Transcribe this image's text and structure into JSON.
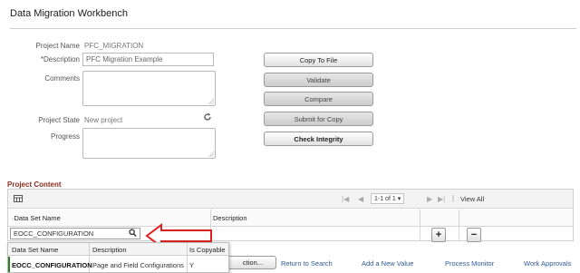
{
  "page": {
    "title": "Data Migration Workbench"
  },
  "form": {
    "project_name_label": "Project Name",
    "project_name_value": "PFC_MIGRATION",
    "description_label": "*Description",
    "description_value": "PFC Migration Example",
    "comments_label": "Comments",
    "project_state_label": "Project State",
    "project_state_value": "New project",
    "progress_label": "Progress"
  },
  "actions": {
    "copy_to_file": "Copy To File",
    "validate": "Validate",
    "compare": "Compare",
    "submit_for_copy": "Submit for Copy",
    "check_integrity": "Check Integrity"
  },
  "content": {
    "section_title": "Project Content",
    "pager_text": "1-1 of 1",
    "view_all": "View All",
    "col_dataset": "·Data Set Name",
    "col_description": "Description",
    "dataset_value": "EOCC_CONFIGURATION",
    "add_label": "+",
    "remove_label": "−"
  },
  "lookup": {
    "headers": [
      "Data Set Name",
      "Description",
      "Is Copyable"
    ],
    "row": [
      "EOCC_CONFIGURATION",
      "Page and Field Configurations",
      "Y"
    ]
  },
  "footer": {
    "partial_button": "ction...",
    "links": [
      "Return to Search",
      "Add a New Value",
      "Process Monitor",
      "Work Approvals"
    ]
  },
  "colors": {
    "section_title": "#8b2b1d",
    "annotation_arrow": "#e02020"
  }
}
